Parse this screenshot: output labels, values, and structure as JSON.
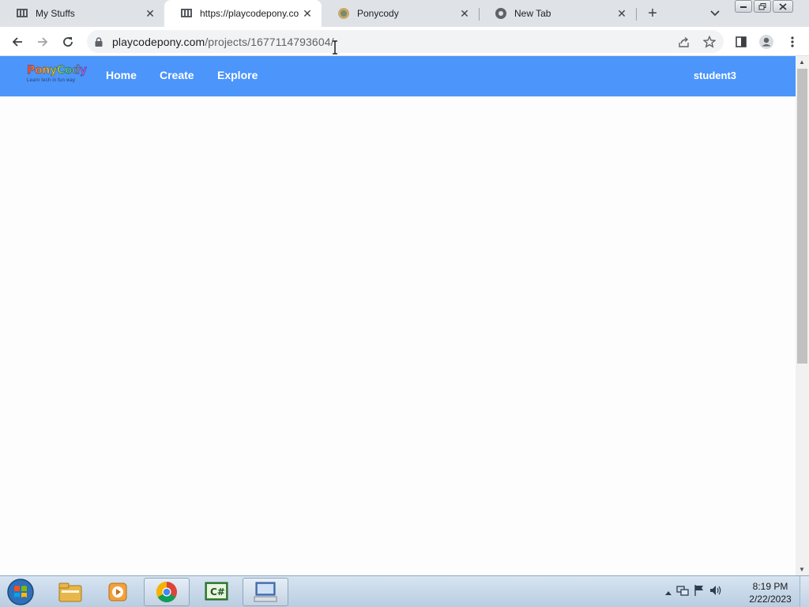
{
  "browser": {
    "tabs": [
      {
        "title": "My Stuffs",
        "icon": "ponycody-favicon-icon",
        "active": false
      },
      {
        "title": "https://playcodepony.com",
        "icon": "ponycody-favicon-icon",
        "active": true
      },
      {
        "title": "Ponycody",
        "icon": "ponycody-round-favicon-icon",
        "active": false
      },
      {
        "title": "New Tab",
        "icon": "chrome-icon",
        "active": false
      }
    ],
    "new_tab_symbol": "+",
    "close_symbol": "✕",
    "address": {
      "host": "playcodepony.com",
      "path": "/projects/1677114793604/"
    }
  },
  "page": {
    "logo": {
      "name": "PonyCody",
      "tagline": "Learn tech in fun way"
    },
    "nav": {
      "home": "Home",
      "create": "Create",
      "explore": "Explore"
    },
    "user": "student3",
    "nav_color": "#4b95fb"
  },
  "taskbar": {
    "apps": [
      "windows-explorer-icon",
      "media-player-icon",
      "chrome-icon",
      "csharp-ide-icon",
      "remote-desktop-icon"
    ],
    "clock": {
      "time": "8:19 PM",
      "date": "2/22/2023"
    }
  }
}
